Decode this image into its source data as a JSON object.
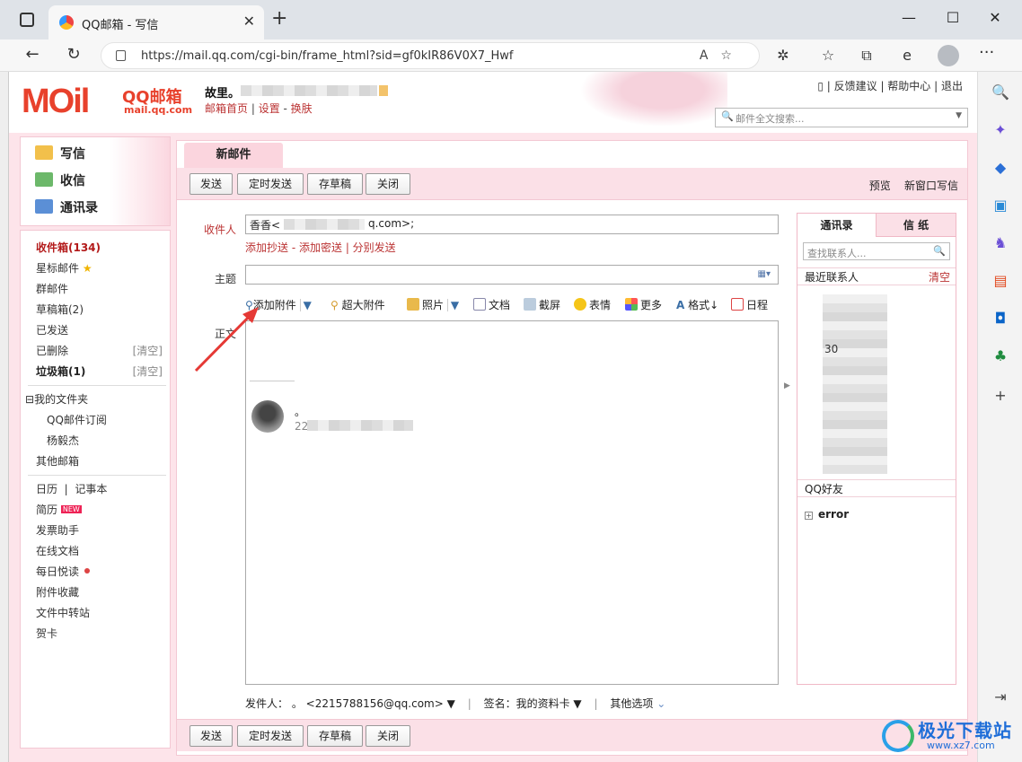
{
  "browser": {
    "tab_title": "QQ邮箱 - 写信",
    "url": "https://mail.qq.com/cgi-bin/frame_html?sid=gf0kIR86V0X7_Hwf"
  },
  "header": {
    "logo_text": "MOil",
    "logo_brand": "QQ邮箱",
    "logo_domain": "mail.qq.com",
    "user_name": "故里。",
    "user_links": [
      "邮箱首页",
      "设置",
      "换肤"
    ],
    "top_links": [
      "反馈建议",
      "帮助中心",
      "退出"
    ],
    "search_placeholder": "邮件全文搜索..."
  },
  "sidebar": {
    "main": [
      "写信",
      "收信",
      "通讯录"
    ],
    "folders": {
      "inbox": "收件箱(134)",
      "starred": "星标邮件",
      "group": "群邮件",
      "drafts": "草稿箱(2)",
      "sent": "已发送",
      "deleted": "已删除",
      "spam": "垃圾箱(1)",
      "clear_label": "[清空]",
      "my_folders": "我的文件夹",
      "qq_subscribe": "QQ邮件订阅",
      "custom_folder": "杨毅杰",
      "other_mailbox": "其他邮箱"
    },
    "tools": {
      "calendar": "日历",
      "notebook": "记事本",
      "resume": "简历",
      "new_badge": "NEW",
      "invoice": "发票助手",
      "online_docs": "在线文档",
      "daily_read": "每日悦读",
      "attach_fav": "附件收藏",
      "transfer": "文件中转站",
      "card": "贺卡"
    }
  },
  "compose": {
    "tab_label": "新邮件",
    "buttons": {
      "send": "发送",
      "scheduled": "定时发送",
      "save_draft": "存草稿",
      "close": "关闭"
    },
    "preview": "预览",
    "new_window": "新窗口写信",
    "recipient_label": "收件人",
    "recipient_value": "香香<",
    "recipient_suffix": "q.com>;",
    "add_links": [
      "添加抄送",
      "添加密送",
      "分别发送"
    ],
    "subject_label": "主题",
    "body_label": "正文",
    "toolbar": {
      "attach": "添加附件",
      "large_attach": "超大附件",
      "photo": "照片",
      "doc": "文档",
      "screenshot": "截屏",
      "emoji": "表情",
      "more": "更多",
      "format": "格式",
      "schedule": "日程"
    },
    "signature_dot": "。",
    "signature_num": "22",
    "sender_label": "发件人：",
    "sender_value": "。 <2215788156@qq.com>",
    "signature_label": "签名：我的资料卡",
    "other_options": "其他选项"
  },
  "contacts": {
    "tab_contacts": "通讯录",
    "tab_paper": "信 纸",
    "search_placeholder": "查找联系人...",
    "recent_label": "最近联系人",
    "clear_label": "清空",
    "partial_num": "30",
    "qq_friends": "QQ好友",
    "group_error": "error"
  },
  "watermark": {
    "text": "极光下载站",
    "url": "www.xz7.com"
  },
  "colors": {
    "brand_red": "#e8412c",
    "link_red": "#b33333",
    "pink_bg": "#fde4ea",
    "annotation_arrow": "#e53935"
  }
}
